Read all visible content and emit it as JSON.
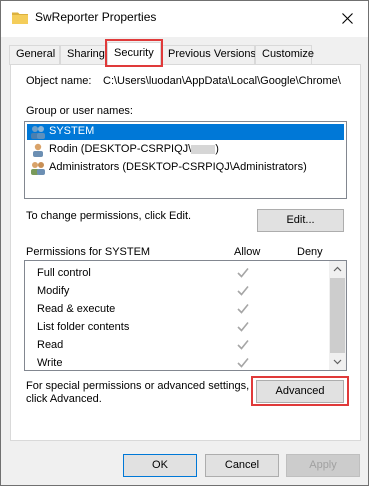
{
  "window": {
    "title": "SwReporter Properties"
  },
  "tabs": [
    {
      "label": "General"
    },
    {
      "label": "Sharing"
    },
    {
      "label": "Security",
      "active": true
    },
    {
      "label": "Previous Versions"
    },
    {
      "label": "Customize"
    }
  ],
  "security": {
    "object_name_label": "Object name:",
    "object_name_value": "C:\\Users\\luodan\\AppData\\Local\\Google\\Chrome\\",
    "group_label": "Group or user names:",
    "users": [
      {
        "name": "SYSTEM",
        "selected": true
      },
      {
        "name": "Rodin (DESKTOP-CSRPIQJ\\",
        "redacted_suffix": true
      },
      {
        "name": "Administrators (DESKTOP-CSRPIQJ\\Administrators)"
      }
    ],
    "change_text": "To change permissions, click Edit.",
    "edit_label": "Edit...",
    "permissions_label": "Permissions for SYSTEM",
    "allow_header": "Allow",
    "deny_header": "Deny",
    "permissions": [
      {
        "name": "Full control",
        "allow": true,
        "deny": false
      },
      {
        "name": "Modify",
        "allow": true,
        "deny": false
      },
      {
        "name": "Read & execute",
        "allow": true,
        "deny": false
      },
      {
        "name": "List folder contents",
        "allow": true,
        "deny": false
      },
      {
        "name": "Read",
        "allow": true,
        "deny": false
      },
      {
        "name": "Write",
        "allow": true,
        "deny": false
      }
    ],
    "special_text_1": "For special permissions or advanced settings,",
    "special_text_2": "click Advanced.",
    "advanced_label": "Advanced"
  },
  "footer": {
    "ok_label": "OK",
    "cancel_label": "Cancel",
    "apply_label": "Apply"
  },
  "colors": {
    "highlight_red": "#e03a3a",
    "selection_blue": "#0078d7",
    "check_gray": "#a6a6a6"
  }
}
